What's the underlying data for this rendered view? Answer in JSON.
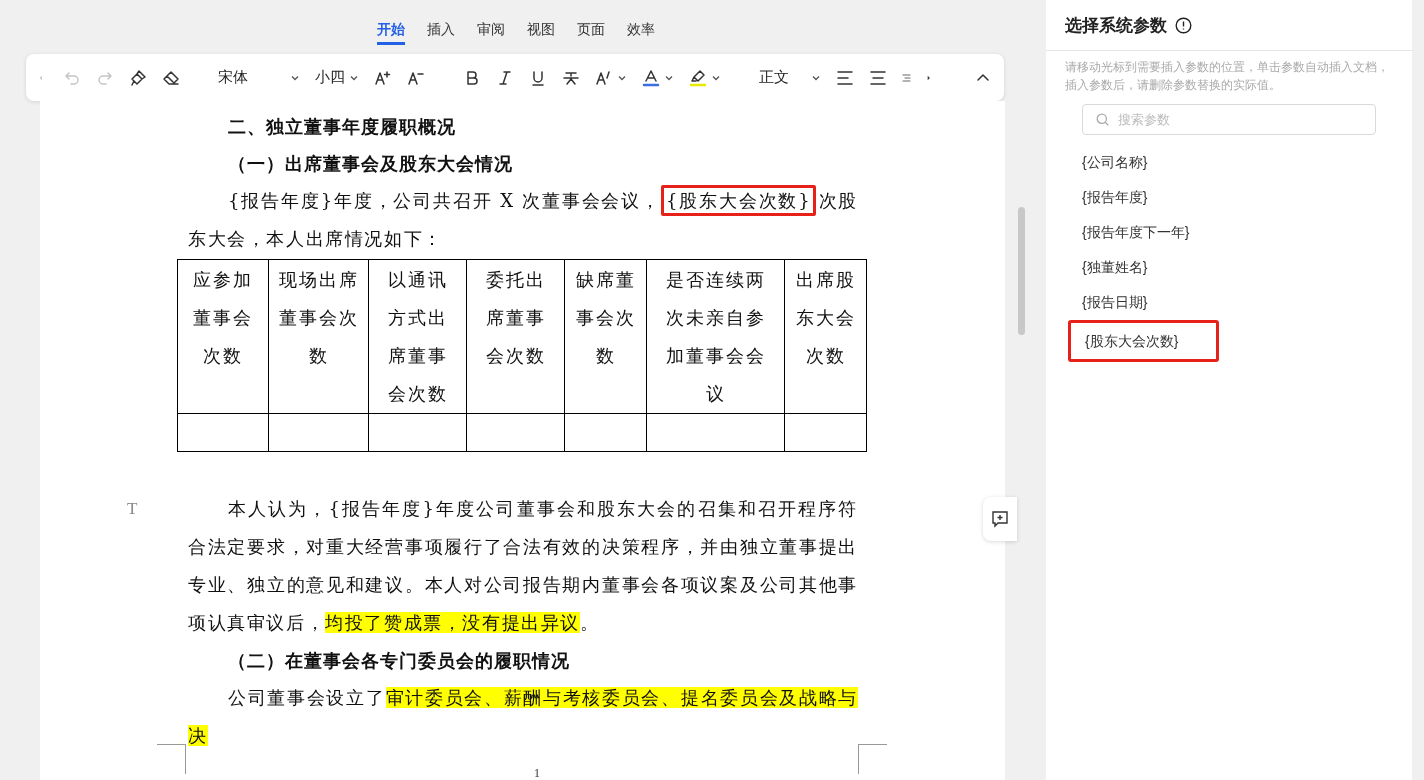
{
  "tabs": [
    {
      "label": "开始",
      "selected": true
    },
    {
      "label": "插入",
      "selected": false
    },
    {
      "label": "审阅",
      "selected": false
    },
    {
      "label": "视图",
      "selected": false
    },
    {
      "label": "页面",
      "selected": false
    },
    {
      "label": "效率",
      "selected": false
    }
  ],
  "toolbar": {
    "back_disabled": true,
    "undo_disabled": true,
    "redo_disabled": true,
    "font": "宋体",
    "size": "小四",
    "paragraph_style": "正文"
  },
  "document": {
    "blocks": [
      {
        "kind": "heading",
        "segments": [
          {
            "text": "二、独立董事年度履职概况",
            "highlighted": false,
            "outlined": false
          }
        ]
      },
      {
        "kind": "heading",
        "segments": [
          {
            "text": "（一）出席董事会及股东大会情况",
            "highlighted": false,
            "outlined": false
          }
        ]
      },
      {
        "kind": "body",
        "segments": [
          {
            "text": "{报告年度}年度，公司共召开 X 次董事会会议，",
            "highlighted": false,
            "outlined": false
          },
          {
            "text": "{股东大会次数}",
            "highlighted": false,
            "outlined": true
          },
          {
            "text": "次股东大会，本人出席情况如下：",
            "highlighted": false,
            "outlined": false
          }
        ]
      },
      {
        "kind": "table",
        "columns": [
          "应参加董事会次数",
          "现场出席董事会次数",
          "以通讯方式出席董事会次数",
          "委托出席董事会次数",
          "缺席董事会次数",
          "是否连续两次未亲自参加董事会会议",
          "出席股东大会次数"
        ]
      },
      {
        "kind": "body",
        "segments": [
          {
            "text": "本人认为，{报告年度}年度公司董事会和股东大会的召集和召开程序符合法定要求，对重大经营事项履行了合法有效的决策程序，并由独立董事提出专业、独立的意见和建议。本人对公司报告期内董事会各项议案及公司其他事项认真审议后，",
            "highlighted": false,
            "outlined": false
          },
          {
            "text": "均投了赞成票，没有提出异议",
            "highlighted": true,
            "outlined": false
          },
          {
            "text": "。",
            "highlighted": false,
            "outlined": false
          }
        ]
      },
      {
        "kind": "heading",
        "segments": [
          {
            "text": "（二）在董事会各专门委员会的履职情况",
            "highlighted": false,
            "outlined": false
          }
        ]
      },
      {
        "kind": "body",
        "segments": [
          {
            "text": "公司董事会设立了",
            "highlighted": false,
            "outlined": false
          },
          {
            "text": "审计委员会、薪酬与考核委员会、提名委员会及战略与决",
            "highlighted": true,
            "outlined": false
          }
        ]
      }
    ],
    "margin_marker": "T",
    "page_number": "1"
  },
  "panel": {
    "title": "选择系统参数",
    "hint": "请移动光标到需要插入参数的位置，单击参数自动插入文档，插入参数后，请删除参数替换的实际值。",
    "search": {
      "placeholder": "搜索参数"
    },
    "params": [
      {
        "label": "{公司名称}",
        "outlined": false
      },
      {
        "label": "{报告年度}",
        "outlined": false
      },
      {
        "label": "{报告年度下一年}",
        "outlined": false
      },
      {
        "label": "{独董姓名}",
        "outlined": false
      },
      {
        "label": "{报告日期}",
        "outlined": false
      },
      {
        "label": "{股东大会次数}",
        "outlined": true
      }
    ]
  }
}
